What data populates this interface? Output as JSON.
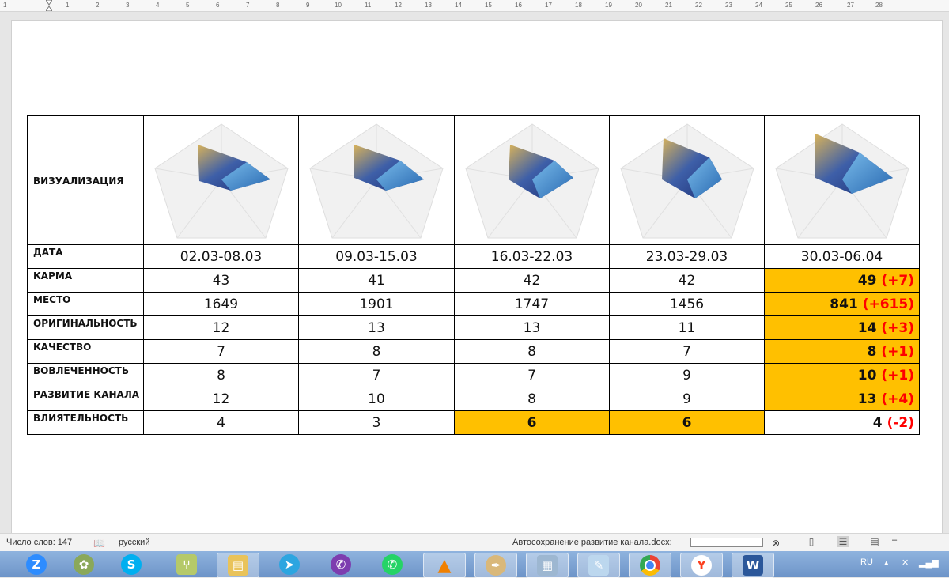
{
  "ruler": {
    "labels": [
      "1",
      "1",
      "2",
      "3",
      "4",
      "5",
      "6",
      "7",
      "8",
      "9",
      "10",
      "11",
      "12",
      "13",
      "14",
      "15",
      "16",
      "17",
      "18",
      "19",
      "20",
      "21",
      "22",
      "23",
      "24",
      "25",
      "26",
      "27",
      "28"
    ]
  },
  "table": {
    "row_labels": {
      "viz": "ВИЗУАЛИЗАЦИЯ",
      "date": "ДАТА",
      "karma": "КАРМА",
      "place": "МЕСТО",
      "originality": "ОРИГИНАЛЬНОСТЬ",
      "quality": "КАЧЕСТВО",
      "engagement": "ВОВЛЕЧЕННОСТЬ",
      "growth": "РАЗВИТИЕ КАНАЛА",
      "influence": "ВЛИЯТЕЛЬНОСТЬ"
    },
    "dates": [
      "02.03-08.03",
      "09.03-15.03",
      "16.03-22.03",
      "23.03-29.03",
      "30.03-06.04"
    ],
    "karma": [
      "43",
      "41",
      "42",
      "42",
      "49"
    ],
    "place": [
      "1649",
      "1901",
      "1747",
      "1456",
      "841"
    ],
    "originality": [
      "12",
      "13",
      "13",
      "11",
      "14"
    ],
    "quality": [
      "7",
      "8",
      "8",
      "7",
      "8"
    ],
    "engagement": [
      "8",
      "7",
      "7",
      "9",
      "10"
    ],
    "growth": [
      "12",
      "10",
      "8",
      "9",
      "13"
    ],
    "influence": [
      "4",
      "3",
      "6",
      "6",
      "4"
    ],
    "deltas": {
      "karma": "(+7)",
      "place": "(+615)",
      "originality": "(+3)",
      "quality": "(+1)",
      "engagement": "(+1)",
      "growth": "(+4)",
      "influence": "(-2)"
    },
    "highlight_color": "#ffc000",
    "delta_color": "#ff0000"
  },
  "status": {
    "word_count": "Число слов: 147",
    "language": "русский",
    "autosave": "Автосохранение развитие канала.docx:"
  },
  "taskbar": {
    "items": [
      "zoom-app-icon",
      "flower-icon",
      "skype-icon",
      "mindmap-icon",
      "folder-icon",
      "telegram-icon",
      "viber-icon",
      "whatsapp-icon",
      "vlc-icon",
      "paint-icon",
      "calculator-icon",
      "notepad-icon",
      "chrome-icon",
      "yandex-icon",
      "word-icon"
    ],
    "tray_lang": "RU"
  }
}
